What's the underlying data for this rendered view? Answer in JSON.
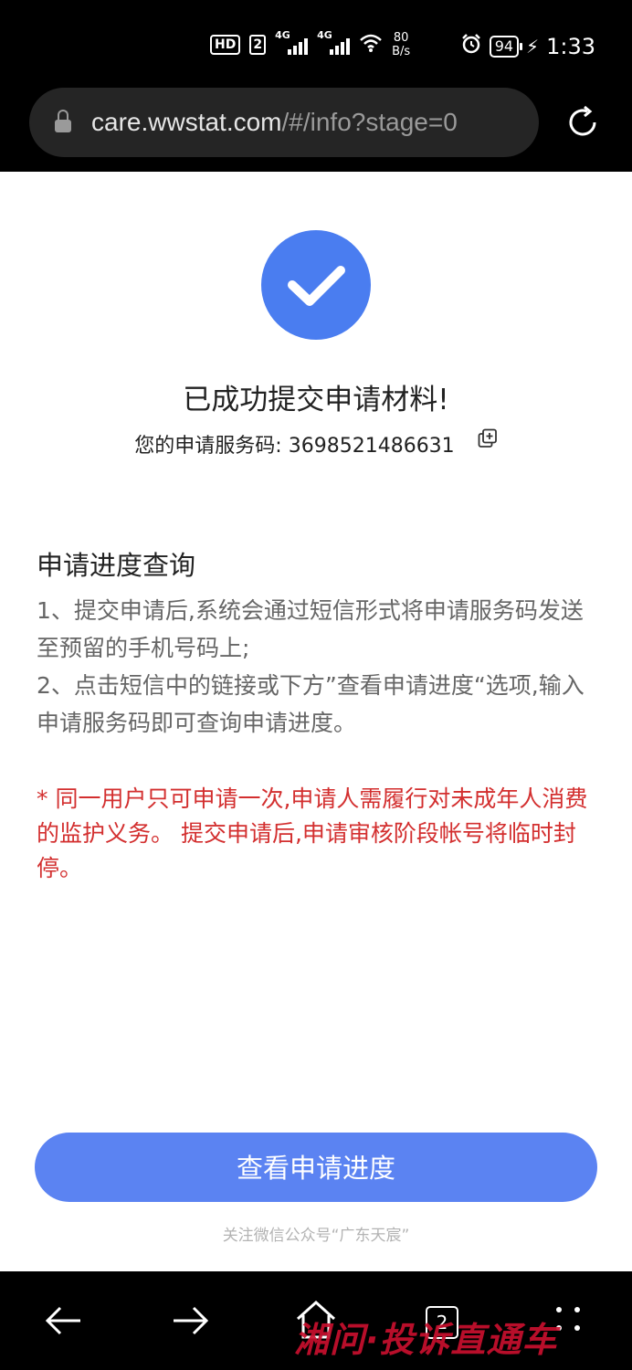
{
  "status_bar": {
    "hd": "HD",
    "sim": "2",
    "net1": "4G",
    "net2": "4G",
    "speed_value": "80",
    "speed_unit": "B/s",
    "battery": "94",
    "time": "1:33"
  },
  "browser": {
    "url_host": "care.wwstat.com",
    "url_path": "/#/info?stage=0"
  },
  "main": {
    "title": "已成功提交申请材料!",
    "code_label": "您的申请服务码:",
    "code_value": "3698521486631",
    "section_title": "申请进度查询",
    "step1": "1、提交申请后,系统会通过短信形式将申请服务码发送至预留的手机号码上;",
    "step2": "2、点击短信中的链接或下方”查看申请进度“选项,输入申请服务码即可查询申请进度。",
    "warning": "* 同一用户只可申请一次,申请人需履行对未成年人消费的监护义务。 提交申请后,申请审核阶段帐号将临时封停。",
    "cta_label": "查看申请进度",
    "footer": "关注微信公众号“广东天宸”"
  },
  "navbar": {
    "tabs_count": "2",
    "watermark_red": "湘问·投诉直通车"
  },
  "colors": {
    "accent": "#4a7df0",
    "button": "#5b83f2",
    "warning": "#d32f2f"
  }
}
